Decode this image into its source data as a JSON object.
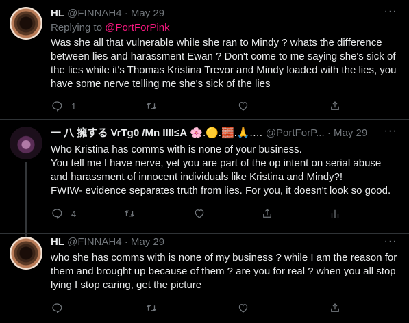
{
  "tweets": [
    {
      "name": "HL",
      "handle": "@FINNAH4",
      "dot": "·",
      "date": "May 29",
      "replying_prefix": "Replying to ",
      "replying_to": "@PortForPink",
      "text": "Was she all that vulnerable while she ran to Mindy ? whats the difference between lies and harassment Ewan  ? Don't come to me saying she's sick of the lies while it's Thomas Kristina Trevor and Mindy loaded with the lies, you have some nerve telling me she's sick of the lies",
      "reply_count": "1",
      "more": "···"
    },
    {
      "name": "一 八 擁する VrTg0 /Mn IIII≤A",
      "emoji_tail": "🌸.🟡.🧱.🙏.…",
      "handle": "@PortForP...",
      "dot": "·",
      "date": "May 29",
      "text": "Who Kristina has comms with is none of your business.\nYou tell me I have nerve, yet you are part of the op intent on serial abuse and harassment of innocent individuals like Kristina and Mindy?!\nFWIW- evidence separates truth from lies. For you, it doesn't look so good.",
      "reply_count": "4",
      "more": "···"
    },
    {
      "name": "HL",
      "handle": "@FINNAH4",
      "dot": "·",
      "date": "May 29",
      "text": "who she has comms with is none of my business ? while I am the reason for them and brought up because of them ? are you for real ? when you all stop lying I stop caring, get the picture",
      "more": "···"
    }
  ],
  "icons": [
    "reply-icon",
    "retweet-icon",
    "like-icon",
    "share-icon",
    "analytics-icon",
    "more-icon"
  ],
  "colors": {
    "background": "#000000",
    "text": "#e7e9ea",
    "muted": "#71767b",
    "mention": "#f91880",
    "divider": "#2f3336"
  }
}
